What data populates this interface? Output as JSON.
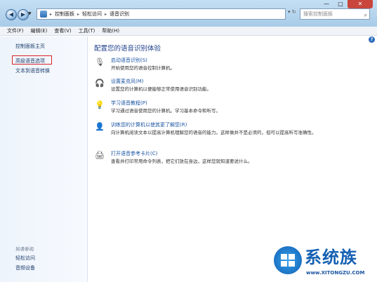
{
  "window": {
    "breadcrumb": [
      "控制面板",
      "轻松访问",
      "语音识别"
    ],
    "search_placeholder": "搜索控制面板",
    "controls": {
      "minimize": "—",
      "maximize": "□",
      "close": "✕"
    }
  },
  "menu": [
    "文件(F)",
    "编辑(E)",
    "查看(V)",
    "工具(T)",
    "帮助(H)"
  ],
  "sidebar": {
    "items": [
      "控制面板主页",
      "高级语音选项",
      "文本到语音转换"
    ],
    "see_also_label": "另请参阅",
    "see_also": [
      "轻松访问",
      "音频设备"
    ]
  },
  "main": {
    "title": "配置您的语音识别体验",
    "items": [
      {
        "icon": "microphone-icon",
        "title": "启动语音识别(S)",
        "desc": "开始使用您的语音控制计算机。"
      },
      {
        "icon": "headset-icon",
        "title": "设置麦克风(M)",
        "desc": "设置您的计算机以便能够正常使用语音识别功能。"
      },
      {
        "icon": "lightbulb-icon",
        "title": "学习语音教程(P)",
        "desc": "学习通过语音使用您的计算机。学习基本命令和听写。"
      },
      {
        "icon": "user-icon",
        "title": "训练您的计算机以使其更了解您(R)",
        "desc": "向计算机阅读文本以提高计算机理解您的语音的能力。这样做并不是必须的，但可以提高听写准确性。"
      },
      {
        "icon": "printer-icon",
        "title": "打开语音参考卡片(C)",
        "desc": "查看并打印常用命令列表，把它们放在身边，这样您就知道要说什么。"
      }
    ]
  },
  "branding": {
    "name": "系统族",
    "url": "www.XITONGZU.COM"
  }
}
